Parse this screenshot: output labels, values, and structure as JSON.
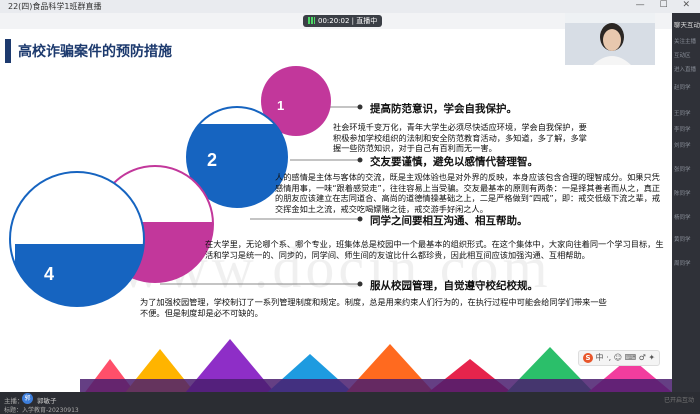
{
  "window": {
    "title": "22(四)食品科学1班群直播",
    "controls": "— ☐ ✕"
  },
  "live": {
    "timer": "00:20:02",
    "status": "直播中"
  },
  "slide": {
    "title": "高校诈骗案件的预防措施",
    "watermark": "www.docin.com",
    "circles": [
      {
        "num": "1",
        "color": "#c2379b"
      },
      {
        "num": "2",
        "color": "#1664c0"
      },
      {
        "num": "3",
        "color": "#c2379b"
      },
      {
        "num": "4",
        "color": "#1664c0"
      }
    ],
    "items": [
      {
        "heading": "提高防范意识，学会自我保护。",
        "body": "社会环境千变万化，青年大学生必须尽快适应环境，学会自我保护，要积极参加学校组织的法制和安全防范教育活动，多知道，多了解，多掌握一些防范知识，对于自己有百利而无一害。"
      },
      {
        "heading": "交友要谨慎，避免以感情代替理智。",
        "body": "人的感情是主体与客体的交流，既是主观体验也是对外界的反映，本身应该包含合理的理智成分。如果只凭感情用事，一味“跟着感觉走”，往往容易上当受骗。交友最基本的原则有两条：一是择其善者而从之，真正的朋友应该建立在志同道合、高尚的道德情操基础之上，二是严格做到“四戒”，即：戒交低级下流之辈，戒交挥金如土之流，戒交吃喝嫖赌之徒，戒交游手好闲之人。"
      },
      {
        "heading": "同学之间要相互沟通、相互帮助。",
        "body": "在大学里，无论哪个系、哪个专业，班集体总是校园中一个最基本的组织形式。在这个集体中，大家向往着同一个学习目标，生活和学习是统一的、同步的，同学间、师生间的友谊比什么都珍贵，因此相互间应该加强沟通、互相帮助。"
      },
      {
        "heading": "服从校园管理，自觉遵守校纪校规。",
        "body": "为了加强校园管理，学校制订了一系列管理制度和规定。制度，总是用来约束人们行为的，在执行过程中可能会给同学们带来一些不便。但是制度却是必不可缺的。"
      }
    ]
  },
  "ime": {
    "label": "中 ·, ☺ ⌨ ♂ ✦"
  },
  "chat": {
    "header": "聊天互动",
    "messages": [
      "关注主播",
      "互动区",
      "进入直播",
      "赵同学",
      "王同学",
      "李同学",
      "刘同学",
      "张同学",
      "陈同学",
      "杨同学",
      "黄同学",
      "周同学"
    ]
  },
  "footer": {
    "host_label": "主播：",
    "host_name": "郭敏子",
    "avatar": "郭",
    "topic": "标题：入学教育-20230913",
    "right": "已开启互动"
  }
}
